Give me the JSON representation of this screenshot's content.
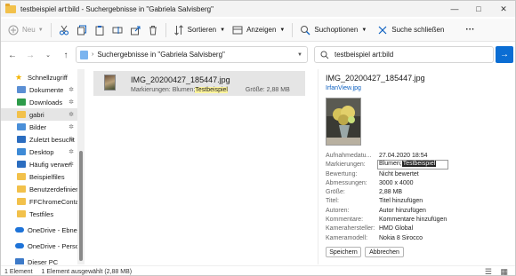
{
  "window": {
    "title": "testbeispiel art:bild - Suchergebnisse in \"Gabriela Salvisberg\""
  },
  "toolbar": {
    "new_label": "Neu",
    "sort_label": "Sortieren",
    "view_label": "Anzeigen",
    "search_options_label": "Suchoptionen",
    "close_search_label": "Suche schließen",
    "more_label": "···"
  },
  "address": {
    "path": "Suchergebnisse in \"Gabriela Salvisberg\"",
    "search_value": "testbeispiel art:bild"
  },
  "sidebar": {
    "items": [
      {
        "label": "Schnellzugriff",
        "icon": "star-icon",
        "color": "#f4b400"
      },
      {
        "label": "Dokumente",
        "icon": "documents-icon",
        "color": "#5b8fd4",
        "pinned": true
      },
      {
        "label": "Downloads",
        "icon": "downloads-icon",
        "color": "#2d9b4a",
        "pinned": true
      },
      {
        "label": "gabri",
        "icon": "folder-icon",
        "color": "#f2c14b",
        "pinned": true,
        "selected": true
      },
      {
        "label": "Bilder",
        "icon": "pictures-icon",
        "color": "#4a8fd8",
        "pinned": true
      },
      {
        "label": "Zuletzt besucht",
        "icon": "recent-icon",
        "color": "#2b6dc0",
        "pinned": true
      },
      {
        "label": "Desktop",
        "icon": "desktop-icon",
        "color": "#3d8ad6",
        "pinned": true
      },
      {
        "label": "Häufig verwen",
        "icon": "frequent-icon",
        "color": "#2b6dc0",
        "pinned": true
      },
      {
        "label": "Beispielfiles",
        "icon": "folder-icon",
        "color": "#f2c14b"
      },
      {
        "label": "Benutzerdefiniert",
        "icon": "folder-icon",
        "color": "#f2c14b"
      },
      {
        "label": "FFChromeContain",
        "icon": "folder-icon",
        "color": "#f2c14b"
      },
      {
        "label": "Testfiles",
        "icon": "folder-icon",
        "color": "#f2c14b"
      },
      {
        "label": "OneDrive - Ebner M",
        "icon": "onedrive-icon",
        "color": "#1e73d8",
        "gap": true
      },
      {
        "label": "OneDrive - Persona",
        "icon": "onedrive-icon",
        "color": "#1e73d8",
        "gap": true
      },
      {
        "label": "Dieser PC",
        "icon": "pc-icon",
        "color": "#3d7ac8",
        "gap": true
      }
    ]
  },
  "results": {
    "file_name": "IMG_20200427_185447.jpg",
    "tags_label": "Markierungen:",
    "tags_value": "Blumen;",
    "tags_highlight": "Testbeispiel",
    "size_label": "Größe:",
    "size_value": "2,88 MB"
  },
  "preview": {
    "file_name": "IMG_20200427_185447.jpg",
    "app_name": "IrfanView.jpg",
    "props": [
      {
        "k": "Aufnahmedatu...",
        "v": "27.04.2020 18:54"
      },
      {
        "k": "Markierungen:",
        "v": ""
      },
      {
        "k": "Bewertung:",
        "v": "Nicht bewertet"
      },
      {
        "k": "Abmessungen:",
        "v": "3000 x 4000"
      },
      {
        "k": "Größe:",
        "v": "2,88 MB"
      },
      {
        "k": "Titel:",
        "v": "Titel hinzufügen"
      },
      {
        "k": "Autoren:",
        "v": "Autor hinzufügen"
      },
      {
        "k": "Kommentare:",
        "v": "Kommentare hinzufügen"
      },
      {
        "k": "Kamerahersteller:",
        "v": "HMD Global"
      },
      {
        "k": "Kameramodell:",
        "v": "Nokia 8 Sirocco"
      }
    ],
    "tag_edit_prefix": "Blumen;",
    "tag_edit_selected": "Testbeispiel",
    "save_label": "Speichern",
    "cancel_label": "Abbrechen"
  },
  "status": {
    "count": "1 Element",
    "selected": "1 Element ausgewählt (2,88 MB)"
  },
  "colors": {
    "accent": "#0b6dd3",
    "selection": "#e5e5e5",
    "highlight": "#fff59d"
  }
}
